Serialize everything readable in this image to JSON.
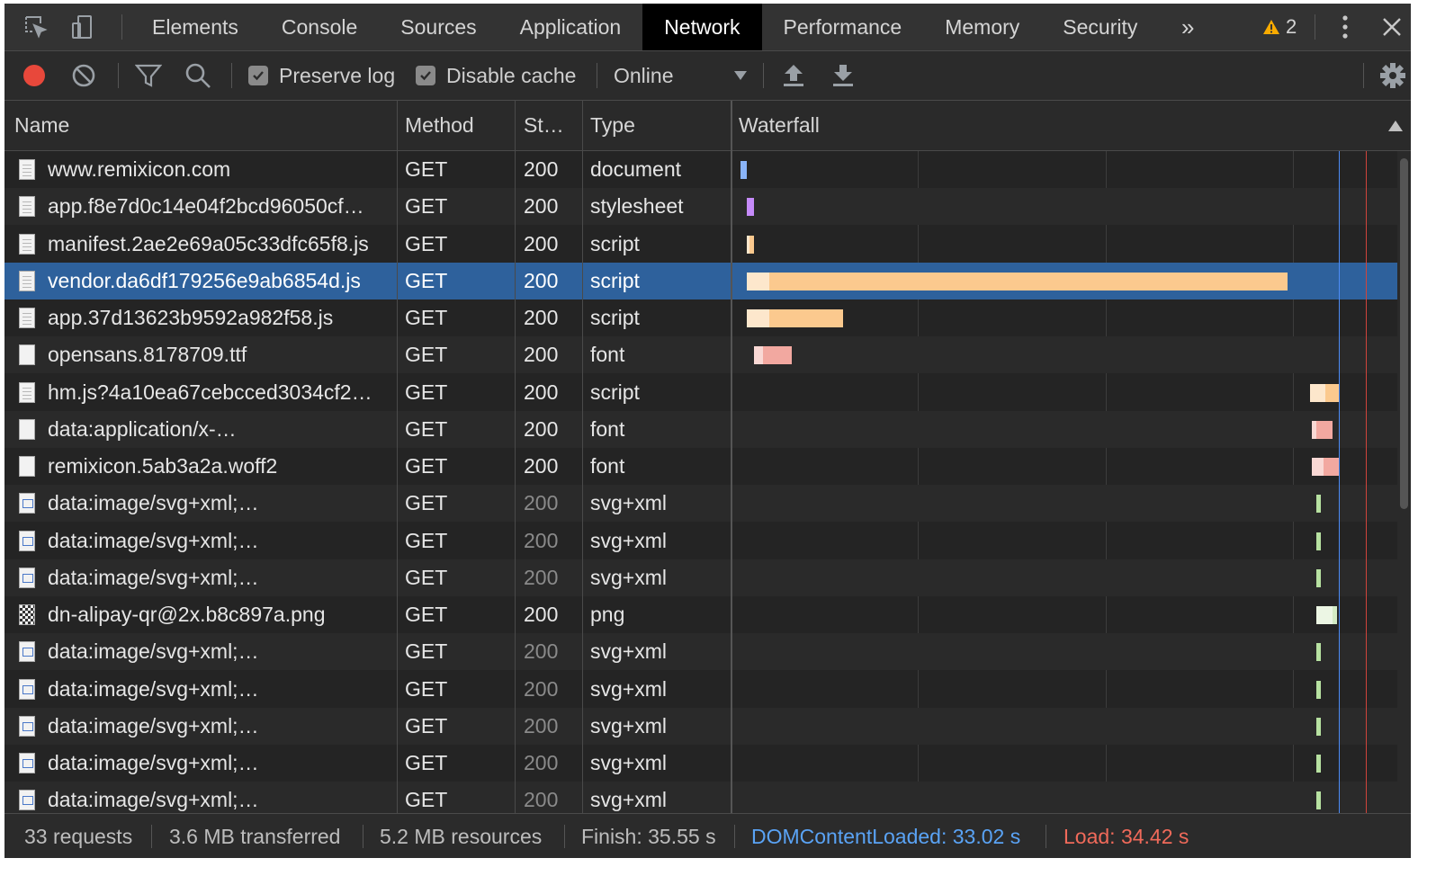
{
  "tabbar": {
    "tabs": [
      "Elements",
      "Console",
      "Sources",
      "Application",
      "Network",
      "Performance",
      "Memory",
      "Security"
    ],
    "active_tab": "Network",
    "more_label": "»",
    "warning_count": "2"
  },
  "toolbar": {
    "preserve_log": "Preserve log",
    "disable_cache": "Disable cache",
    "throttle": "Online",
    "record_color": "#e8483b"
  },
  "columns": {
    "name": "Name",
    "method": "Method",
    "status": "St…",
    "type": "Type",
    "waterfall": "Waterfall"
  },
  "requests": [
    {
      "name": "www.remixicon.com",
      "method": "GET",
      "status": "200",
      "type": "document",
      "icon": "document-file-icon",
      "wf": {
        "start": 0.0,
        "wait": 0.0,
        "end": 0.3,
        "color": "#8ab4f8"
      }
    },
    {
      "name": "app.f8e7d0c14e04f2bcd96050cf…",
      "method": "GET",
      "status": "200",
      "type": "stylesheet",
      "icon": "document-file-icon",
      "wf": {
        "start": 0.3,
        "wait": 0.3,
        "end": 0.6,
        "color": "#c58af9"
      }
    },
    {
      "name": "manifest.2ae2e69a05c33dfc65f8.js",
      "method": "GET",
      "status": "200",
      "type": "script",
      "icon": "document-file-icon",
      "wf": {
        "start": 0.3,
        "wait": 0.4,
        "end": 0.6,
        "color": "#fbc98e"
      }
    },
    {
      "name": "vendor.da6df179256e9ab6854d.js",
      "method": "GET",
      "status": "200",
      "type": "script",
      "icon": "document-file-icon",
      "selected": true,
      "wf": {
        "start": 0.3,
        "wait": 1.3,
        "end": 24.6,
        "color": "#fbc98e"
      }
    },
    {
      "name": "app.37d13623b9592a982f58.js",
      "method": "GET",
      "status": "200",
      "type": "script",
      "icon": "document-file-icon",
      "wf": {
        "start": 0.3,
        "wait": 1.3,
        "end": 4.6,
        "color": "#fbc98e"
      }
    },
    {
      "name": "opensans.8178709.ttf",
      "method": "GET",
      "status": "200",
      "type": "font",
      "icon": "blank-file-icon",
      "wf": {
        "start": 0.6,
        "wait": 1.0,
        "end": 2.3,
        "color": "#f2a8a0"
      }
    },
    {
      "name": "hm.js?4a10ea67cebcced3034cf2…",
      "method": "GET",
      "status": "200",
      "type": "script",
      "icon": "document-file-icon",
      "wf": {
        "start": 25.6,
        "wait": 26.3,
        "end": 26.9,
        "color": "#fbc98e"
      }
    },
    {
      "name": "data:application/x-…",
      "method": "GET",
      "status": "200",
      "type": "font",
      "icon": "blank-file-icon",
      "wf": {
        "start": 25.7,
        "wait": 25.9,
        "end": 26.6,
        "color": "#f2a8a0"
      }
    },
    {
      "name": "remixicon.5ab3a2a.woff2",
      "method": "GET",
      "status": "200",
      "type": "font",
      "icon": "blank-file-icon",
      "wf": {
        "start": 25.7,
        "wait": 26.2,
        "end": 26.9,
        "color": "#f2a8a0"
      }
    },
    {
      "name": "data:image/svg+xml;…",
      "method": "GET",
      "status": "200",
      "status_dim": true,
      "type": "svg+xml",
      "icon": "svg-image-icon",
      "wf": {
        "start": 25.9,
        "wait": 25.9,
        "end": 26.1,
        "color": "#b7e1a1"
      }
    },
    {
      "name": "data:image/svg+xml;…",
      "method": "GET",
      "status": "200",
      "status_dim": true,
      "type": "svg+xml",
      "icon": "svg-image-icon",
      "wf": {
        "start": 25.9,
        "wait": 25.9,
        "end": 26.1,
        "color": "#b7e1a1"
      }
    },
    {
      "name": "data:image/svg+xml;…",
      "method": "GET",
      "status": "200",
      "status_dim": true,
      "type": "svg+xml",
      "icon": "svg-image-icon",
      "wf": {
        "start": 25.9,
        "wait": 25.9,
        "end": 26.1,
        "color": "#b7e1a1"
      }
    },
    {
      "name": "dn-alipay-qr@2x.b8c897a.png",
      "method": "GET",
      "status": "200",
      "type": "png",
      "icon": "qr-image-icon",
      "wf": {
        "start": 25.9,
        "wait": 26.6,
        "end": 26.8,
        "color": "#d4ecc4"
      }
    },
    {
      "name": "data:image/svg+xml;…",
      "method": "GET",
      "status": "200",
      "status_dim": true,
      "type": "svg+xml",
      "icon": "svg-image-icon",
      "wf": {
        "start": 25.9,
        "wait": 25.9,
        "end": 26.1,
        "color": "#b7e1a1"
      }
    },
    {
      "name": "data:image/svg+xml;…",
      "method": "GET",
      "status": "200",
      "status_dim": true,
      "type": "svg+xml",
      "icon": "svg-image-icon",
      "wf": {
        "start": 25.9,
        "wait": 25.9,
        "end": 26.1,
        "color": "#b7e1a1"
      }
    },
    {
      "name": "data:image/svg+xml;…",
      "method": "GET",
      "status": "200",
      "status_dim": true,
      "type": "svg+xml",
      "icon": "svg-image-icon",
      "wf": {
        "start": 25.9,
        "wait": 25.9,
        "end": 26.1,
        "color": "#b7e1a1"
      }
    },
    {
      "name": "data:image/svg+xml;…",
      "method": "GET",
      "status": "200",
      "status_dim": true,
      "type": "svg+xml",
      "icon": "svg-image-icon",
      "wf": {
        "start": 25.9,
        "wait": 25.9,
        "end": 26.1,
        "color": "#b7e1a1"
      }
    },
    {
      "name": "data:image/svg+xml;…",
      "method": "GET",
      "status": "200",
      "status_dim": true,
      "type": "svg+xml",
      "icon": "svg-image-icon",
      "wf": {
        "start": 25.9,
        "wait": 25.9,
        "end": 26.1,
        "color": "#b7e1a1"
      }
    }
  ],
  "waterfall": {
    "max_seconds": 28.8,
    "dom_content_loaded_s": 26.9,
    "load_s": 28.1,
    "dcl_color": "#4c8bf5",
    "load_color": "#d0443c"
  },
  "footer": {
    "requests": "33 requests",
    "transferred": "3.6 MB transferred",
    "resources": "5.2 MB resources",
    "finish": "Finish: 35.55 s",
    "dom_content_loaded": "DOMContentLoaded: 33.02 s",
    "load": "Load: 34.42 s",
    "dcl_color": "#5aa3f5",
    "load_color": "#f06a5a"
  }
}
